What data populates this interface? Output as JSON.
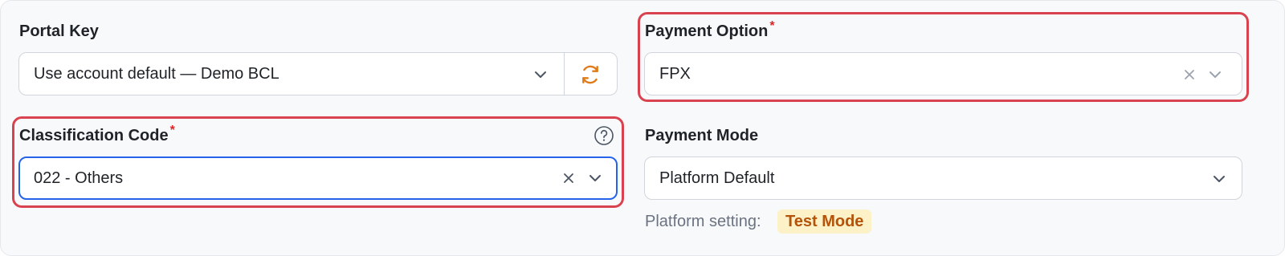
{
  "portal_key": {
    "label": "Portal Key",
    "value": "Use account default — Demo BCL",
    "chevron_icon": "chevron-down-icon",
    "refresh_icon": "refresh-icon",
    "refresh_color": "#e07a16"
  },
  "payment_option": {
    "label": "Payment Option",
    "required_mark": "*",
    "value": "FPX",
    "clear_icon": "close-icon",
    "chevron_icon": "chevron-down-icon"
  },
  "classification_code": {
    "label": "Classification Code",
    "required_mark": "*",
    "value": "022 - Others",
    "help_icon": "help-circle-icon",
    "clear_icon": "close-icon",
    "chevron_icon": "chevron-down-icon",
    "focus_color": "#2563eb"
  },
  "payment_mode": {
    "label": "Payment Mode",
    "value": "Platform Default",
    "chevron_icon": "chevron-down-icon",
    "hint_label": "Platform setting:",
    "badge": "Test Mode"
  },
  "highlight_color": "#d9434f"
}
